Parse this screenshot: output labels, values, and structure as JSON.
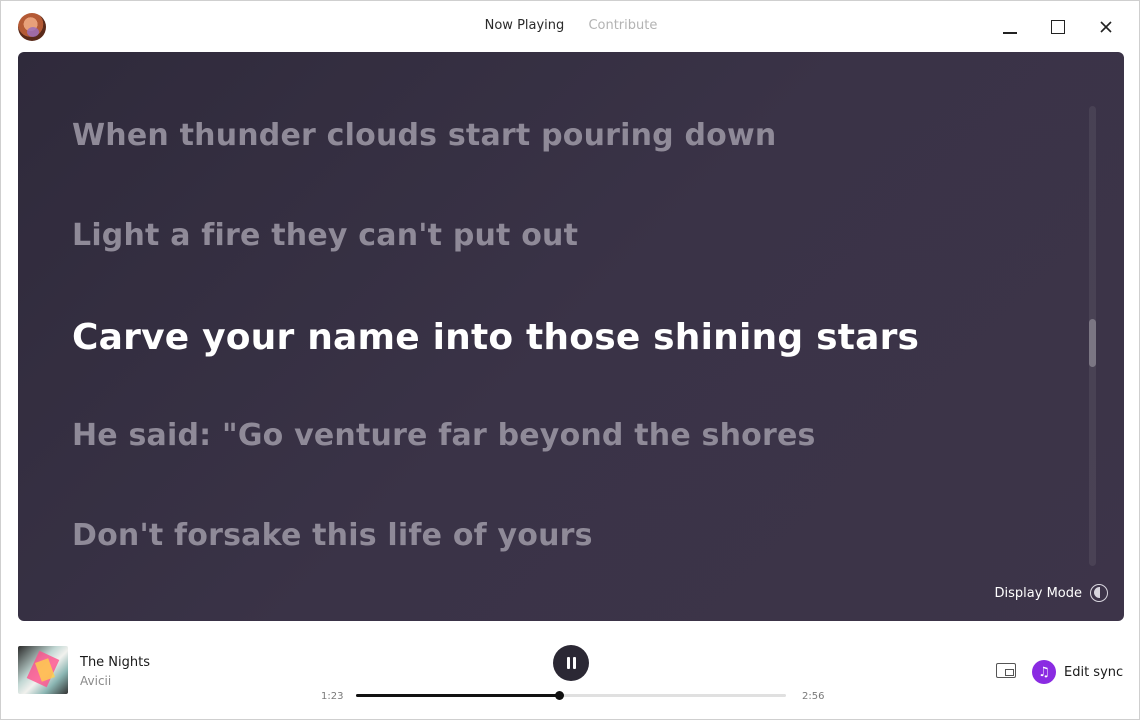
{
  "header": {
    "tabs": [
      {
        "label": "Now Playing",
        "active": true
      },
      {
        "label": "Contribute",
        "active": false
      }
    ]
  },
  "lyrics": {
    "lines": [
      "When thunder clouds start pouring down",
      "Light a fire they can't put out",
      "Carve your name into those shining stars",
      "He said: \"Go venture far beyond the shores",
      "Don't forsake this life of yours"
    ],
    "active_index": 2,
    "display_mode_label": "Display Mode"
  },
  "player": {
    "title": "The Nights",
    "artist": "Avicii",
    "current_time": "1:23",
    "total_time": "2:56",
    "progress_fraction": 0.4716,
    "state": "playing",
    "edit_sync_label": "Edit sync"
  },
  "colors": {
    "panel_bg": "#3a3347",
    "accent": "#8a2be2",
    "active_lyric": "#ffffff",
    "inactive_lyric": "#8f8a98"
  },
  "icons": {
    "avatar": "user-avatar",
    "play_pause": "pause-icon",
    "display_mode": "half-circle-icon",
    "miniplayer": "miniplayer-icon",
    "sync": "music-note-icon"
  }
}
